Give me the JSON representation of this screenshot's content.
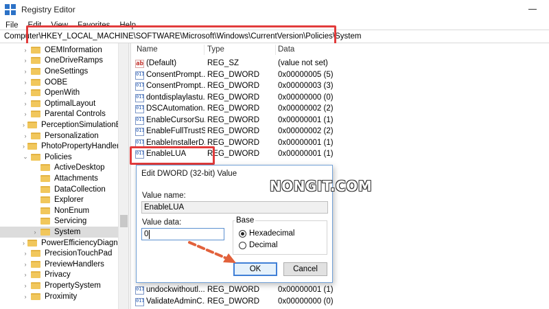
{
  "window": {
    "title": "Registry Editor"
  },
  "menu": [
    "File",
    "Edit",
    "View",
    "Favorites",
    "Help"
  ],
  "address": "Computer\\HKEY_LOCAL_MACHINE\\SOFTWARE\\Microsoft\\Windows\\CurrentVersion\\Policies\\System",
  "tree": [
    {
      "label": "OEMInformation",
      "depth": 0,
      "chevron": "›"
    },
    {
      "label": "OneDriveRamps",
      "depth": 0,
      "chevron": "›"
    },
    {
      "label": "OneSettings",
      "depth": 0,
      "chevron": "›"
    },
    {
      "label": "OOBE",
      "depth": 0,
      "chevron": "›"
    },
    {
      "label": "OpenWith",
      "depth": 0,
      "chevron": "›"
    },
    {
      "label": "OptimalLayout",
      "depth": 0,
      "chevron": "›"
    },
    {
      "label": "Parental Controls",
      "depth": 0,
      "chevron": "›"
    },
    {
      "label": "PerceptionSimulationEx",
      "depth": 0,
      "chevron": "›"
    },
    {
      "label": "Personalization",
      "depth": 0,
      "chevron": "›"
    },
    {
      "label": "PhotoPropertyHandler",
      "depth": 0,
      "chevron": "›"
    },
    {
      "label": "Policies",
      "depth": 0,
      "chevron": "⌄"
    },
    {
      "label": "ActiveDesktop",
      "depth": 1,
      "chevron": ""
    },
    {
      "label": "Attachments",
      "depth": 1,
      "chevron": ""
    },
    {
      "label": "DataCollection",
      "depth": 1,
      "chevron": ""
    },
    {
      "label": "Explorer",
      "depth": 1,
      "chevron": ""
    },
    {
      "label": "NonEnum",
      "depth": 1,
      "chevron": ""
    },
    {
      "label": "Servicing",
      "depth": 1,
      "chevron": ""
    },
    {
      "label": "System",
      "depth": 1,
      "chevron": "›",
      "selected": true
    },
    {
      "label": "PowerEfficiencyDiagnos",
      "depth": 0,
      "chevron": "›"
    },
    {
      "label": "PrecisionTouchPad",
      "depth": 0,
      "chevron": "›"
    },
    {
      "label": "PreviewHandlers",
      "depth": 0,
      "chevron": "›"
    },
    {
      "label": "Privacy",
      "depth": 0,
      "chevron": "›"
    },
    {
      "label": "PropertySystem",
      "depth": 0,
      "chevron": "›"
    },
    {
      "label": "Proximity",
      "depth": 0,
      "chevron": "›"
    }
  ],
  "columns": {
    "name": "Name",
    "type": "Type",
    "data": "Data"
  },
  "values": [
    {
      "icon": "string-value-icon",
      "glyph": "ab",
      "name": "(Default)",
      "type": "REG_SZ",
      "data": "(value not set)"
    },
    {
      "icon": "dword-value-icon",
      "glyph": "011",
      "name": "ConsentPrompt...",
      "type": "REG_DWORD",
      "data": "0x00000005 (5)"
    },
    {
      "icon": "dword-value-icon",
      "glyph": "011",
      "name": "ConsentPrompt...",
      "type": "REG_DWORD",
      "data": "0x00000003 (3)"
    },
    {
      "icon": "dword-value-icon",
      "glyph": "011",
      "name": "dontdisplaylastu...",
      "type": "REG_DWORD",
      "data": "0x00000000 (0)"
    },
    {
      "icon": "dword-value-icon",
      "glyph": "011",
      "name": "DSCAutomation...",
      "type": "REG_DWORD",
      "data": "0x00000002 (2)"
    },
    {
      "icon": "dword-value-icon",
      "glyph": "011",
      "name": "EnableCursorSu...",
      "type": "REG_DWORD",
      "data": "0x00000001 (1)"
    },
    {
      "icon": "dword-value-icon",
      "glyph": "011",
      "name": "EnableFullTrustS...",
      "type": "REG_DWORD",
      "data": "0x00000002 (2)"
    },
    {
      "icon": "dword-value-icon",
      "glyph": "011",
      "name": "EnableInstallerD...",
      "type": "REG_DWORD",
      "data": "0x00000001 (1)"
    },
    {
      "icon": "dword-value-icon",
      "glyph": "011",
      "name": "EnableLUA",
      "type": "REG_DWORD",
      "data": "0x00000001 (1)"
    },
    {
      "icon": "dword-value-icon",
      "glyph": "011",
      "name": "undockwithoutl...",
      "type": "REG_DWORD",
      "data": "0x00000001 (1)"
    },
    {
      "icon": "dword-value-icon",
      "glyph": "011",
      "name": "ValidateAdminC...",
      "type": "REG_DWORD",
      "data": "0x00000000 (0)"
    }
  ],
  "dialog": {
    "title": "Edit DWORD (32-bit) Value",
    "value_name_label": "Value name:",
    "value_name": "EnableLUA",
    "value_data_label": "Value data:",
    "value_data": "0",
    "base_label": "Base",
    "hex_label": "Hexadecimal",
    "dec_label": "Decimal",
    "base_selected": "Hexadecimal",
    "ok_label": "OK",
    "cancel_label": "Cancel"
  },
  "watermark": "NONGIT.COM",
  "colors": {
    "highlight": "#e23b3b",
    "arrow": "#e2613b",
    "accent": "#3f7fd6",
    "folder": "#f1c75c"
  }
}
